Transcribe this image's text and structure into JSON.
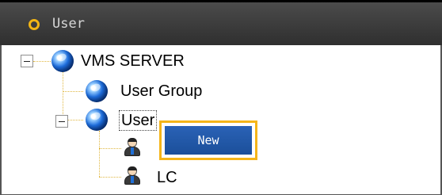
{
  "title": "User",
  "tree": {
    "root": "VMS SERVER",
    "user_group": "User Group",
    "user": "User",
    "lc": "LC"
  },
  "context_menu": {
    "new": "New"
  }
}
